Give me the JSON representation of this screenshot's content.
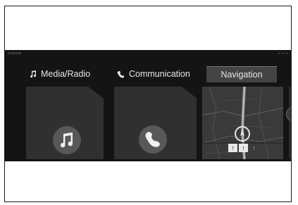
{
  "tabs": {
    "media": {
      "label": "Media/Radio",
      "icon": "music-note-icon"
    },
    "communication": {
      "label": "Communication",
      "icon": "phone-icon"
    },
    "navigation": {
      "label": "Navigation",
      "selected": true
    }
  },
  "tiles": {
    "media": {
      "icon": "music-note-icon"
    },
    "communication": {
      "icon": "phone-icon"
    },
    "navigation": {
      "arrows": [
        "↑",
        "↑",
        "↑"
      ]
    }
  },
  "next": {
    "label": "›",
    "icon": "chevron-right-icon"
  },
  "colors": {
    "screen": "#141414",
    "tile": "#303030",
    "selected_tab": "#444444"
  }
}
